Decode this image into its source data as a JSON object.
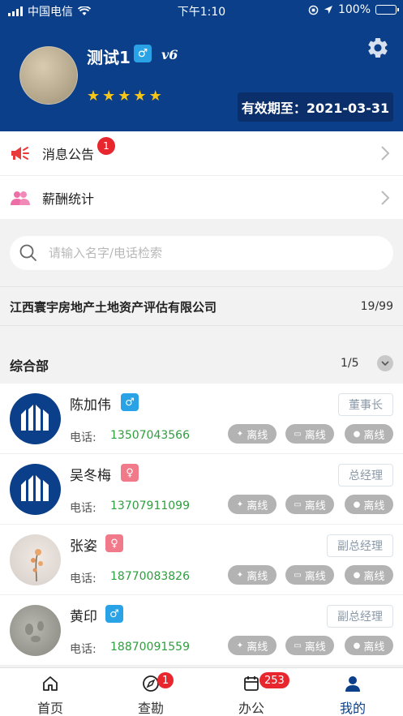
{
  "status_bar": {
    "carrier": "中国电信",
    "time": "下午1:10",
    "battery": "100%"
  },
  "profile": {
    "name": "测试1",
    "gender_symbol": "♂",
    "vip_level": "v6",
    "stars": 5,
    "expiry": "有效期至：2021-03-31",
    "settings_icon": "gear-icon"
  },
  "menu": {
    "items": [
      {
        "label": "消息公告",
        "badge": "1",
        "icon": "megaphone-icon"
      },
      {
        "label": "薪酬统计",
        "icon": "people-icon"
      }
    ]
  },
  "search": {
    "placeholder": "请输入名字/电话检索"
  },
  "company": {
    "name": "江西寰宇房地产土地资产评估有限公司",
    "count": "19/99"
  },
  "department": {
    "name": "综合部",
    "page": "1/5"
  },
  "employees": [
    {
      "name": "陈加伟",
      "gender": "male",
      "gender_symbol": "♂",
      "title": "董事长",
      "phone_label": "电话:",
      "phone": "13507043566",
      "avatar": "logo",
      "status": [
        "离线",
        "离线",
        "离线"
      ]
    },
    {
      "name": "吴冬梅",
      "gender": "female",
      "gender_symbol": "♀",
      "title": "总经理",
      "phone_label": "电话:",
      "phone": "13707911099",
      "avatar": "logo",
      "status": [
        "离线",
        "离线",
        "离线"
      ]
    },
    {
      "name": "张姿",
      "gender": "female",
      "gender_symbol": "♀",
      "title": "副总经理",
      "phone_label": "电话:",
      "phone": "18770083826",
      "avatar": "flower",
      "status": [
        "离线",
        "离线",
        "离线"
      ]
    },
    {
      "name": "黄印",
      "gender": "male",
      "gender_symbol": "♂",
      "title": "副总经理",
      "phone_label": "电话:",
      "phone": "18870091559",
      "avatar": "sand",
      "status": [
        "离线",
        "离线",
        "离线"
      ]
    }
  ],
  "tabbar": {
    "tabs": [
      {
        "label": "首页",
        "icon": "home-icon"
      },
      {
        "label": "查勘",
        "icon": "compass-icon",
        "badge": "1"
      },
      {
        "label": "办公",
        "icon": "calendar-icon",
        "badge": "253"
      },
      {
        "label": "我的",
        "icon": "user-icon",
        "active": true
      }
    ]
  },
  "colors": {
    "header_bg": "#0b3f8a",
    "phone_green": "#2e9e3e",
    "badge_red": "#e8262d",
    "male_blue": "#2aa3e6",
    "female_pink": "#f07a8a"
  }
}
